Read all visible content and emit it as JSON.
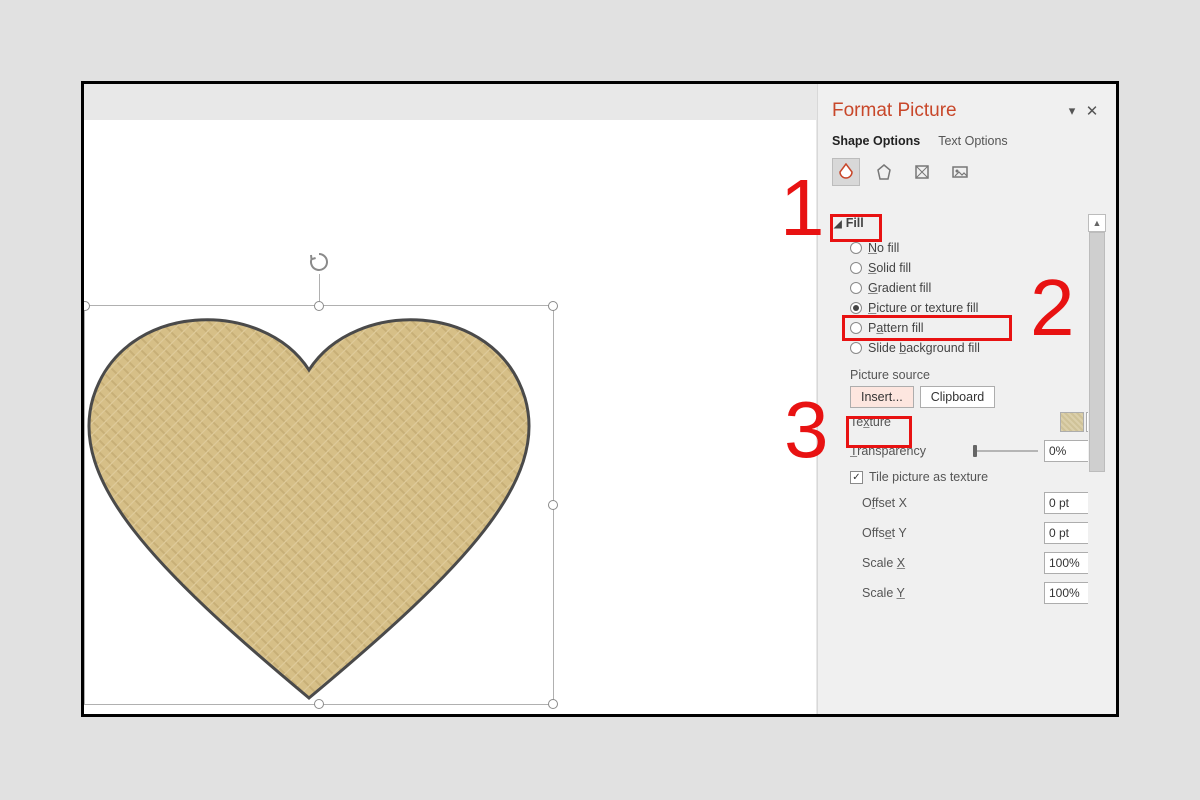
{
  "pane": {
    "title": "Format Picture",
    "tabs": {
      "shape": "Shape Options",
      "text": "Text Options"
    },
    "section_fill": "Fill",
    "radios": {
      "no_fill": "No fill",
      "solid": "Solid fill",
      "gradient": "Gradient fill",
      "picture": "Picture or texture fill",
      "pattern": "Pattern fill",
      "slide_bg": "Slide background fill"
    },
    "picture_source_label": "Picture source",
    "insert_btn": "Insert...",
    "clipboard_btn": "Clipboard",
    "texture_label": "Texture",
    "transparency_label": "Transparency",
    "transparency_value": "0%",
    "tile_label": "Tile picture as texture",
    "offset_x_label": "Offset X",
    "offset_x_value": "0 pt",
    "offset_y_label": "Offset Y",
    "offset_y_value": "0 pt",
    "scale_x_label": "Scale X",
    "scale_x_value": "100%",
    "scale_y_label": "Scale Y",
    "scale_y_value": "100%"
  },
  "annotations": {
    "n1": "1",
    "n2": "2",
    "n3": "3"
  }
}
